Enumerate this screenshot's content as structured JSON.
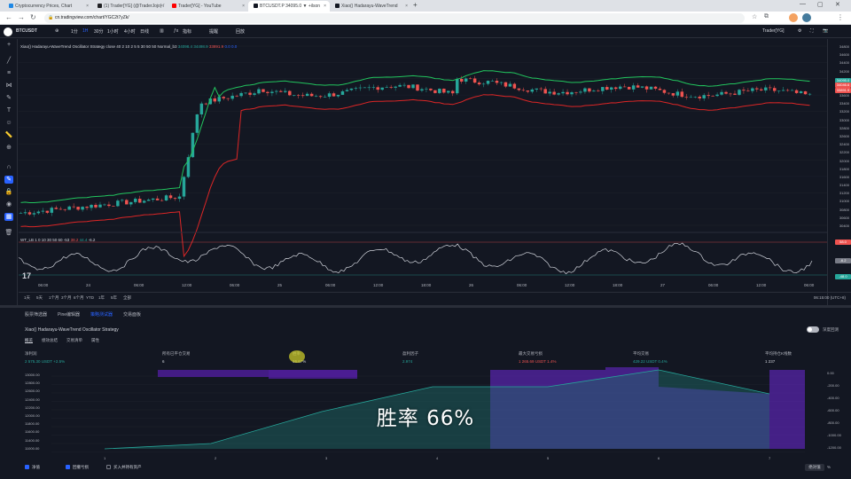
{
  "browser": {
    "tabs": [
      {
        "label": "Cryptocurrency Prices, Chart",
        "color": "#1e88e5",
        "left": 4,
        "width": 100
      },
      {
        "label": "(1) Trader[YG] (@TraderJojo) /",
        "color": "#202124",
        "left": 104,
        "width": 84
      },
      {
        "label": "Trader[YG] - YouTube",
        "color": "#ff0000",
        "left": 188,
        "width": 92
      },
      {
        "label": "BTCUSDT.P 34095.0 ▼ +ilson",
        "color": "#131722",
        "left": 280,
        "width": 92,
        "active": true
      },
      {
        "label": "Xiao() Hadarayu-WaveTrend",
        "color": "#131722",
        "left": 372,
        "width": 92
      }
    ],
    "new_tab": "+",
    "url": "cn.tradingview.com/chart/YGC2t7yZk/",
    "window_controls": [
      "—",
      "▢",
      "✕"
    ]
  },
  "tv_header": {
    "symbol": "BTCUSDT",
    "interval_items": [
      "1分",
      "1H",
      "30分",
      "1小时",
      "4小时",
      "日线"
    ],
    "toolbar_items": [
      "指标",
      "提醒",
      "回放"
    ],
    "user": "Trader[YG]"
  },
  "chart": {
    "legend_title": "Xiao() Hadarayu-WaveTrend Oscillator Strategy",
    "legend_params": "close 40 2 10 2 5 5 30 50 50 Normal_b3",
    "legend_vals": [
      "34098.4",
      "34498.9",
      "33891.9"
    ],
    "legend_extra": "0.0  0.0",
    "osc_legend": "WT_LB  1 0 10 30 50 60 -53",
    "osc_vals": [
      "38.2",
      "44.4",
      "-6.2"
    ],
    "y_ticks": [
      "34800",
      "34600",
      "34400",
      "34200",
      "34000",
      "33800",
      "33600",
      "33400",
      "33200",
      "33000",
      "32800",
      "32600",
      "32400",
      "32200",
      "32000",
      "31800",
      "31600",
      "31400",
      "31200",
      "31000",
      "30800",
      "30600",
      "30400"
    ],
    "price_tags": [
      {
        "label": "34095.0",
        "color": "#26a69a"
      },
      {
        "label": "34046.6",
        "color": "#ef5350"
      },
      {
        "label": "33891.9",
        "color": "#ef5350"
      }
    ],
    "osc_tags": [
      {
        "label": "58.0",
        "color": "#ef5350"
      },
      {
        "label": "-6.2",
        "color": "#787b86"
      },
      {
        "label": "-48.0",
        "color": "#26a69a"
      }
    ],
    "time_ticks": [
      "06:00",
      "24",
      "06:00",
      "12:00",
      "06:00",
      "25",
      "06:00",
      "12:00",
      "18:00",
      "26",
      "06:00",
      "12:00",
      "18:00",
      "27",
      "06:00",
      "12:00",
      "06:00"
    ],
    "ranges": [
      "1天",
      "5天",
      "1个月",
      "3个月",
      "6个月",
      "YTD",
      "1年",
      "5年",
      "全部"
    ],
    "timezone": "06:15:00 (UTC+8)",
    "tv_mark": "17"
  },
  "panel": {
    "tabs": [
      "股票筛选器",
      "Pine编辑器",
      "策略测试器",
      "交易面板"
    ],
    "active_tab": 2,
    "strategy_title": "Xiao() Hadarayu-WaveTrend Oscillator Strategy",
    "subtabs": [
      "概览",
      "绩效总结",
      "交易清单",
      "属性"
    ],
    "active_subtab": 0,
    "toggle_label": "深度回测",
    "stats": [
      {
        "label": "净利润",
        "value": "2 575.30 USDT  +2.5%",
        "cls": "g",
        "left": 28
      },
      {
        "label": "所有已平仓交易",
        "value": "6",
        "cls": "w",
        "left": 183
      },
      {
        "label": "胜率",
        "value": "66.67%",
        "cls": "w",
        "left": 330
      },
      {
        "label": "盈利因子",
        "value": "2.974",
        "cls": "g",
        "left": 454
      },
      {
        "label": "最大交易亏损",
        "value": "1 265.69 USDT  1.4%",
        "cls": "r",
        "left": 585
      },
      {
        "label": "平均交易",
        "value": "429.22 USDT  0.4%",
        "cls": "g",
        "left": 714
      },
      {
        "label": "平均持仓K线数",
        "value": "1 237",
        "cls": "w",
        "left": 863
      }
    ],
    "eq_left_ticks": [
      "13000.00",
      "12800.00",
      "12600.00",
      "12400.00",
      "12200.00",
      "12000.00",
      "11800.00",
      "11600.00",
      "11400.00",
      "11000.00"
    ],
    "eq_right_ticks": [
      "0.00",
      "-200.00",
      "-400.00",
      "-600.00",
      "-800.00",
      "-1000.00",
      "-1200.00"
    ],
    "eq_x": [
      "1",
      "2",
      "3",
      "4",
      "5",
      "6",
      "7"
    ],
    "checks": [
      {
        "label": "净值",
        "on": true
      },
      {
        "label": "回撤亏损",
        "on": true
      },
      {
        "label": "买入并持有资产",
        "on": false
      }
    ],
    "btn_absolute": "绝对值",
    "btn_percent": "%"
  },
  "subtitle": "胜率 66%",
  "colors": {
    "up": "#26a69a",
    "down": "#ef5350",
    "upper_band": "#22c55e",
    "lower_band": "#dc2626",
    "accent": "#2962ff"
  }
}
